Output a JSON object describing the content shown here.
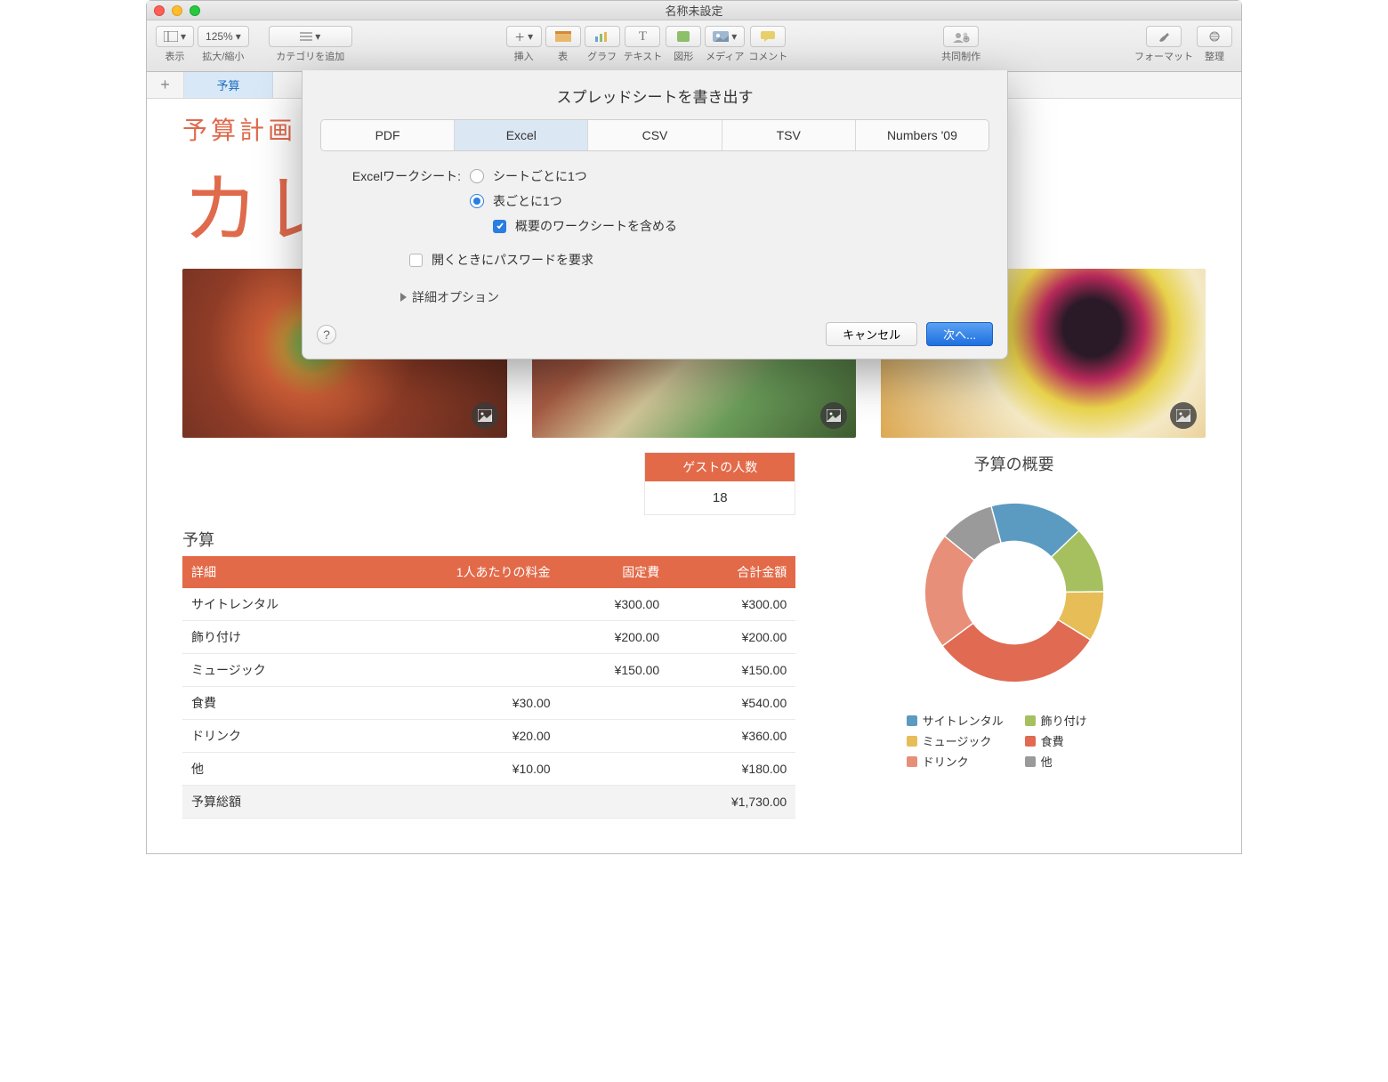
{
  "window": {
    "title": "名称未設定"
  },
  "toolbar": {
    "view": "表示",
    "zoom_value": "125%",
    "zoom_label": "拡大/縮小",
    "category": "カテゴリを追加",
    "insert": "挿入",
    "table": "表",
    "chart": "グラフ",
    "text": "テキスト",
    "shape": "図形",
    "media": "メディア",
    "comment": "コメント",
    "share": "共同制作",
    "format": "フォーマット",
    "organize": "整理"
  },
  "tabs": {
    "active": "予算"
  },
  "document": {
    "subtitle": "予算計画",
    "title_partial": "カレ",
    "guest_header": "ゲストの人数",
    "guest_value": "18",
    "budget_title": "予算",
    "headers": {
      "detail": "詳細",
      "per_person": "1人あたりの料金",
      "fixed": "固定費",
      "total": "合計金額"
    },
    "rows": [
      {
        "name": "サイトレンタル",
        "per": "",
        "fixed": "¥300.00",
        "total": "¥300.00"
      },
      {
        "name": "飾り付け",
        "per": "",
        "fixed": "¥200.00",
        "total": "¥200.00"
      },
      {
        "name": "ミュージック",
        "per": "",
        "fixed": "¥150.00",
        "total": "¥150.00"
      },
      {
        "name": "食費",
        "per": "¥30.00",
        "fixed": "",
        "total": "¥540.00"
      },
      {
        "name": "ドリンク",
        "per": "¥20.00",
        "fixed": "",
        "total": "¥360.00"
      },
      {
        "name": "他",
        "per": "¥10.00",
        "fixed": "",
        "total": "¥180.00"
      }
    ],
    "total_row": {
      "name": "予算総額",
      "total": "¥1,730.00"
    },
    "summary_title": "予算の概要"
  },
  "dialog": {
    "title": "スプレッドシートを書き出す",
    "tabs": {
      "pdf": "PDF",
      "excel": "Excel",
      "csv": "CSV",
      "tsv": "TSV",
      "numbers09": "Numbers '09"
    },
    "worksheet_label": "Excelワークシート:",
    "radio_per_sheet": "シートごとに1つ",
    "radio_per_table": "表ごとに1つ",
    "include_summary": "概要のワークシートを含める",
    "require_password": "開くときにパスワードを要求",
    "advanced": "詳細オプション",
    "cancel": "キャンセル",
    "next": "次へ..."
  },
  "chart_data": {
    "type": "pie",
    "title": "予算の概要",
    "series": [
      {
        "name": "サイトレンタル",
        "value": 17,
        "color": "#5b9bc2"
      },
      {
        "name": "飾り付け",
        "value": 12,
        "color": "#a7c05f"
      },
      {
        "name": "ミュージック",
        "value": 9,
        "color": "#e6bd57"
      },
      {
        "name": "食費",
        "value": 31,
        "color": "#e06a52"
      },
      {
        "name": "ドリンク",
        "value": 21,
        "color": "#e88f79"
      },
      {
        "name": "他",
        "value": 10,
        "color": "#9a9a9a"
      }
    ],
    "legend_position": "bottom"
  }
}
